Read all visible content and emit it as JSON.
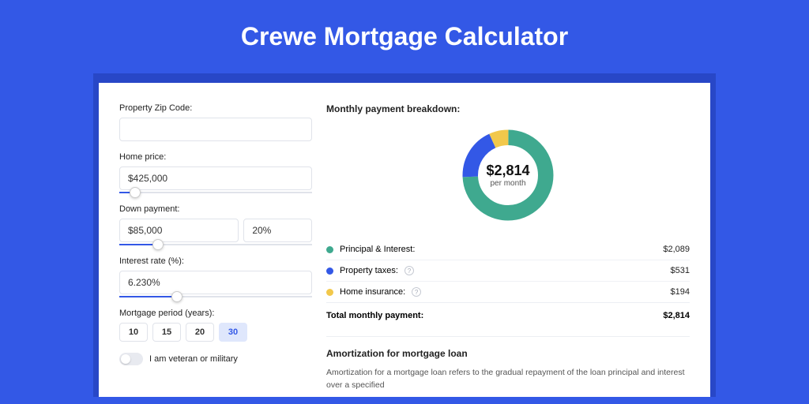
{
  "title": "Crewe Mortgage Calculator",
  "form": {
    "zip_label": "Property Zip Code:",
    "zip_value": "",
    "home_price_label": "Home price:",
    "home_price_value": "$425,000",
    "home_price_slider_pct": 8,
    "down_payment_label": "Down payment:",
    "down_payment_value": "$85,000",
    "down_payment_pct": "20%",
    "down_payment_slider_pct": 20,
    "interest_label": "Interest rate (%):",
    "interest_value": "6.230%",
    "interest_slider_pct": 30,
    "period_label": "Mortgage period (years):",
    "periods": [
      "10",
      "15",
      "20",
      "30"
    ],
    "period_active": "30",
    "veteran_label": "I am veteran or military"
  },
  "breakdown": {
    "title": "Monthly payment breakdown:",
    "total_amount": "$2,814",
    "total_sub": "per month",
    "items": [
      {
        "label": "Principal & Interest:",
        "value": "$2,089",
        "color": "#3fa98f",
        "help": false
      },
      {
        "label": "Property taxes:",
        "value": "$531",
        "color": "#3358e6",
        "help": true
      },
      {
        "label": "Home insurance:",
        "value": "$194",
        "color": "#f2c84b",
        "help": true
      }
    ],
    "total_label": "Total monthly payment:",
    "total_value": "$2,814"
  },
  "chart_data": {
    "type": "pie",
    "title": "Monthly payment breakdown",
    "series": [
      {
        "name": "Principal & Interest",
        "value": 2089,
        "color": "#3fa98f"
      },
      {
        "name": "Property taxes",
        "value": 531,
        "color": "#3358e6"
      },
      {
        "name": "Home insurance",
        "value": 194,
        "color": "#f2c84b"
      }
    ],
    "total": 2814,
    "center_label": "$2,814",
    "center_sub": "per month"
  },
  "amort": {
    "title": "Amortization for mortgage loan",
    "body": "Amortization for a mortgage loan refers to the gradual repayment of the loan principal and interest over a specified"
  }
}
